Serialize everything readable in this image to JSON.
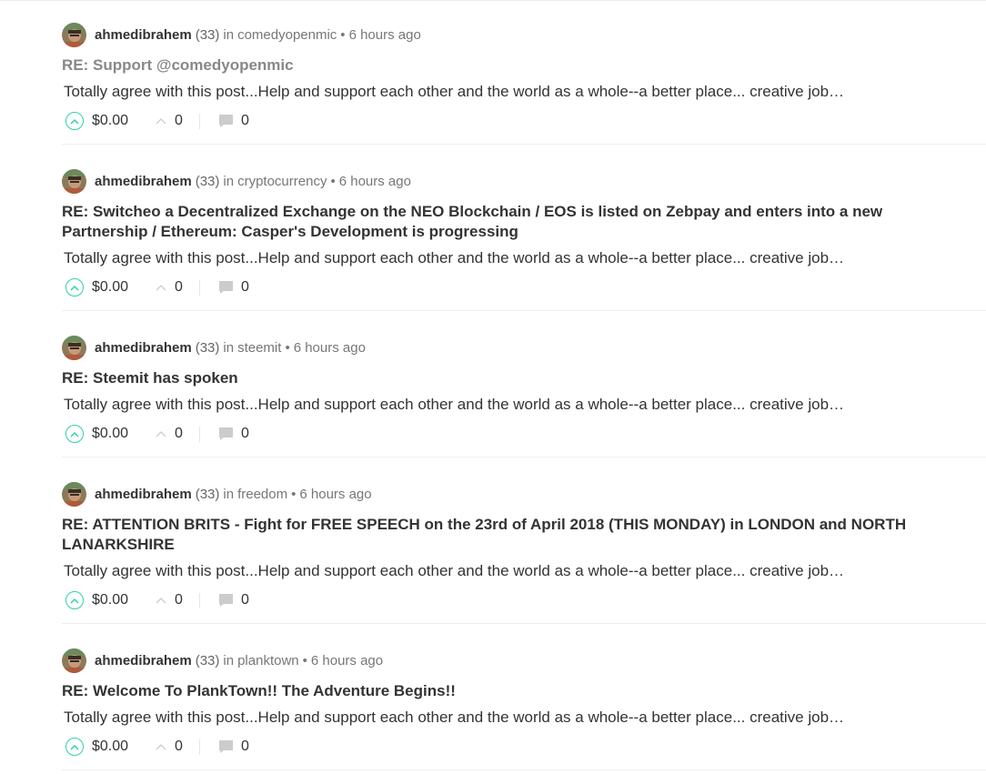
{
  "colors": {
    "upvote_accent": "#2ed3a4",
    "visited_title": "#888888"
  },
  "posts": [
    {
      "author": "ahmedibrahem",
      "reputation": "(33)",
      "in_word": "in",
      "category": "comedyopenmic",
      "separator": "•",
      "time": "6 hours ago",
      "title": "RE: Support @comedyopenmic",
      "excerpt": "Totally agree with this post...Help and support each other and the world as a whole--a better place... creative job…",
      "payout": "$0.00",
      "votes": "0",
      "comments": "0"
    },
    {
      "author": "ahmedibrahem",
      "reputation": "(33)",
      "in_word": "in",
      "category": "cryptocurrency",
      "separator": "•",
      "time": "6 hours ago",
      "title": "RE: Switcheo a Decentralized Exchange on the NEO Blockchain / EOS is listed on Zebpay and enters into a new Partnership / Ethereum: Casper's Development is progressing",
      "excerpt": "Totally agree with this post...Help and support each other and the world as a whole--a better place... creative job…",
      "payout": "$0.00",
      "votes": "0",
      "comments": "0"
    },
    {
      "author": "ahmedibrahem",
      "reputation": "(33)",
      "in_word": "in",
      "category": "steemit",
      "separator": "•",
      "time": "6 hours ago",
      "title": "RE: Steemit has spoken",
      "excerpt": "Totally agree with this post...Help and support each other and the world as a whole--a better place... creative job…",
      "payout": "$0.00",
      "votes": "0",
      "comments": "0"
    },
    {
      "author": "ahmedibrahem",
      "reputation": "(33)",
      "in_word": "in",
      "category": "freedom",
      "separator": "•",
      "time": "6 hours ago",
      "title": "RE: ATTENTION BRITS - Fight for FREE SPEECH on the 23rd of April 2018 (THIS MONDAY) in LONDON and NORTH LANARKSHIRE",
      "excerpt": "Totally agree with this post...Help and support each other and the world as a whole--a better place... creative job…",
      "payout": "$0.00",
      "votes": "0",
      "comments": "0"
    },
    {
      "author": "ahmedibrahem",
      "reputation": "(33)",
      "in_word": "in",
      "category": "planktown",
      "separator": "•",
      "time": "6 hours ago",
      "title": "RE: Welcome To PlankTown!! The Adventure Begins!!",
      "excerpt": "Totally agree with this post...Help and support each other and the world as a whole--a better place... creative job…",
      "payout": "$0.00",
      "votes": "0",
      "comments": "0"
    }
  ]
}
